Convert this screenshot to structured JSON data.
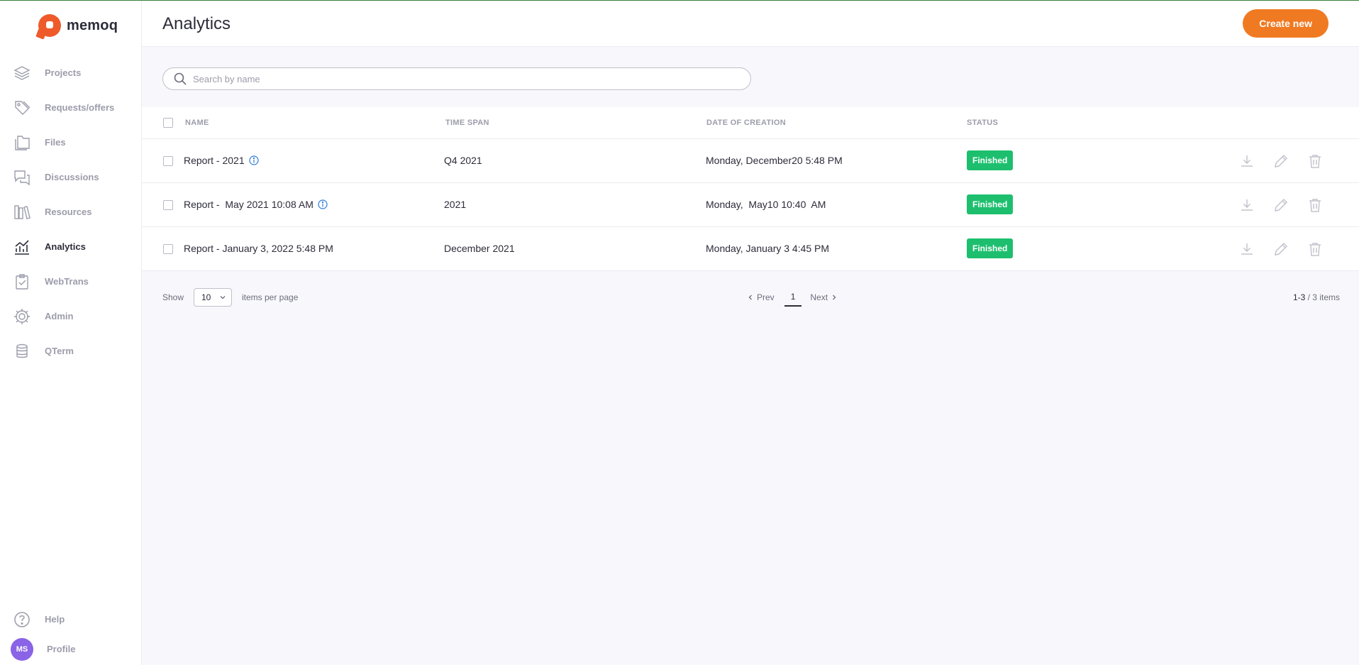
{
  "app": {
    "logo_text": "memoq"
  },
  "sidebar": {
    "items": [
      {
        "label": "Projects",
        "icon": "layers-icon"
      },
      {
        "label": "Requests/offers",
        "icon": "tags-icon"
      },
      {
        "label": "Files",
        "icon": "files-icon"
      },
      {
        "label": "Discussions",
        "icon": "chat-icon"
      },
      {
        "label": "Resources",
        "icon": "books-icon"
      },
      {
        "label": "Analytics",
        "icon": "chart-icon",
        "active": true
      },
      {
        "label": "WebTrans",
        "icon": "clipboard-check-icon"
      },
      {
        "label": "Admin",
        "icon": "gear-icon"
      },
      {
        "label": "QTerm",
        "icon": "database-icon"
      }
    ],
    "help_label": "Help",
    "profile_label": "Profile",
    "profile_initials": "MS"
  },
  "header": {
    "title": "Analytics",
    "create_label": "Create new"
  },
  "search": {
    "placeholder": "Search by name"
  },
  "table": {
    "columns": [
      "NAME",
      "TIME SPAN",
      "DATE OF CREATION",
      "STATUS"
    ],
    "rows": [
      {
        "name": "Report - 2021",
        "time_span": "Q4 2021",
        "created": "Monday, December20 5:48 PM",
        "status": "Finished",
        "info": true
      },
      {
        "name": "Report -  May 2021 10:08 AM",
        "time_span": "2021",
        "created": "Monday,  May10 10:40  AM",
        "status": "Finished",
        "info": true
      },
      {
        "name": "Report - January 3, 2022 5:48 PM",
        "time_span": "December 2021",
        "created": "Monday, January 3 4:45 PM",
        "status": "Finished",
        "info": false
      }
    ]
  },
  "pagination": {
    "show_label": "Show",
    "per_page": "10",
    "per_page_label": "items per page",
    "prev_label": "Prev",
    "current_page": "1",
    "next_label": "Next",
    "range": "1-3",
    "total": "/ 3 items"
  },
  "colors": {
    "accent": "#f07a22",
    "logo": "#ef5a2a",
    "status_finished": "#1dbf6e",
    "avatar": "#8a63e6"
  }
}
